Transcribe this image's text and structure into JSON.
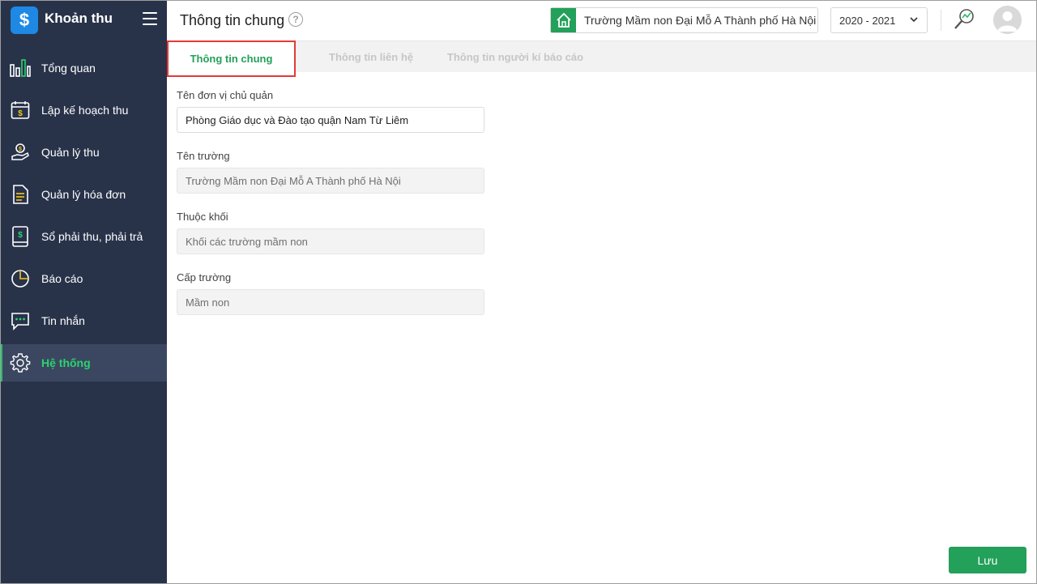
{
  "app": {
    "title": "Khoản thu",
    "logo_symbol": "$"
  },
  "sidebar": {
    "items": [
      {
        "label": "Tổng quan",
        "icon": "bar-chart-icon"
      },
      {
        "label": "Lập kế hoạch thu",
        "icon": "calendar-money-icon"
      },
      {
        "label": "Quản lý thu",
        "icon": "hand-coin-icon"
      },
      {
        "label": "Quản lý hóa đơn",
        "icon": "document-icon"
      },
      {
        "label": "Sổ phải thu, phải trả",
        "icon": "ledger-icon"
      },
      {
        "label": "Báo cáo",
        "icon": "pie-chart-icon"
      },
      {
        "label": "Tin nhắn",
        "icon": "chat-icon"
      },
      {
        "label": "Hệ thống",
        "icon": "gear-icon",
        "active": true
      }
    ]
  },
  "header": {
    "title": "Thông tin chung",
    "help": "?",
    "school": "Trường Mầm non Đại Mỗ A Thành phố Hà Nội",
    "year": "2020 - 2021"
  },
  "tabs": [
    {
      "label": "Thông tin chung",
      "active": true
    },
    {
      "label": "Thông tin liên hệ",
      "active": false
    },
    {
      "label": "Thông tin người kí báo cáo",
      "active": false
    }
  ],
  "form": {
    "fields": [
      {
        "label": "Tên đơn vị chủ quản",
        "value": "Phòng Giáo dục và Đào tạo quận Nam Từ Liêm",
        "editable": true
      },
      {
        "label": "Tên trường",
        "value": "Trường Mầm non Đại Mỗ A Thành phố Hà Nội",
        "editable": false
      },
      {
        "label": "Thuộc khối",
        "value": "Khối các trường mầm non",
        "editable": false
      },
      {
        "label": "Cấp trường",
        "value": "Mầm non",
        "editable": false
      }
    ]
  },
  "actions": {
    "save_label": "Lưu"
  },
  "colors": {
    "sidebar_bg": "#28334a",
    "accent_green": "#23a05a",
    "highlight_red": "#e53935",
    "logo_blue": "#1e88e5"
  }
}
